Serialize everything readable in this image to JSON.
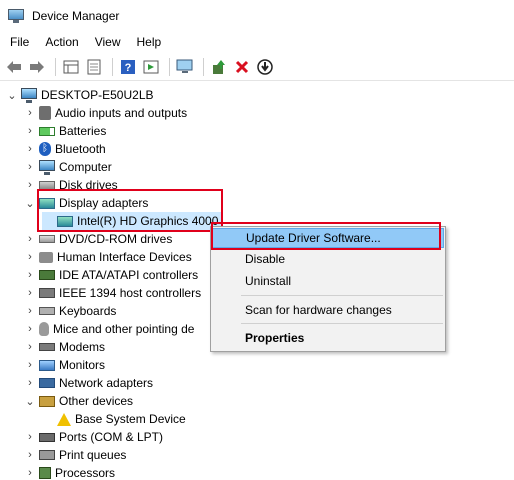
{
  "window": {
    "title": "Device Manager"
  },
  "menu": [
    "File",
    "Action",
    "View",
    "Help"
  ],
  "toolbar": {
    "buttons": [
      "back-arrow-icon",
      "forward-arrow-icon",
      "properties-grid-icon",
      "document-icon",
      "help-icon",
      "run-icon",
      "monitor-scan-icon",
      "update-driver-icon",
      "uninstall-x-icon",
      "download-arrow-icon"
    ],
    "accent_red": "#e0001b"
  },
  "tree": {
    "root": "DESKTOP-E50U2LB",
    "items": [
      {
        "label": "Audio inputs and outputs",
        "icon": "speaker-icon"
      },
      {
        "label": "Batteries",
        "icon": "battery-icon"
      },
      {
        "label": "Bluetooth",
        "icon": "bluetooth-icon"
      },
      {
        "label": "Computer",
        "icon": "computer-icon"
      },
      {
        "label": "Disk drives",
        "icon": "disk-drive-icon"
      },
      {
        "label": "Display adapters",
        "icon": "display-adapter-icon",
        "expanded": true,
        "children": [
          {
            "label": "Intel(R) HD Graphics 4000",
            "icon": "display-adapter-icon",
            "selected": true
          }
        ]
      },
      {
        "label": "DVD/CD-ROM drives",
        "icon": "dvd-icon"
      },
      {
        "label": "Human Interface Devices",
        "icon": "hid-icon"
      },
      {
        "label": "IDE ATA/ATAPI controllers",
        "icon": "ide-controller-icon"
      },
      {
        "label": "IEEE 1394 host controllers",
        "icon": "ieee1394-icon"
      },
      {
        "label": "Keyboards",
        "icon": "keyboard-icon"
      },
      {
        "label": "Mice and other pointing de",
        "icon": "mouse-icon"
      },
      {
        "label": "Modems",
        "icon": "modem-icon"
      },
      {
        "label": "Monitors",
        "icon": "monitor-icon"
      },
      {
        "label": "Network adapters",
        "icon": "network-adapter-icon"
      },
      {
        "label": "Other devices",
        "icon": "other-devices-icon",
        "expanded": true,
        "children": [
          {
            "label": "Base System Device",
            "icon": "warning-icon"
          }
        ]
      },
      {
        "label": "Ports (COM & LPT)",
        "icon": "ports-icon"
      },
      {
        "label": "Print queues",
        "icon": "printer-icon"
      },
      {
        "label": "Processors",
        "icon": "processor-icon"
      }
    ]
  },
  "context_menu": {
    "items": [
      {
        "label": "Update Driver Software...",
        "active": true
      },
      {
        "label": "Disable"
      },
      {
        "label": "Uninstall"
      },
      {
        "label": "Scan for hardware changes"
      },
      {
        "label": "Properties",
        "bold": true
      }
    ]
  }
}
